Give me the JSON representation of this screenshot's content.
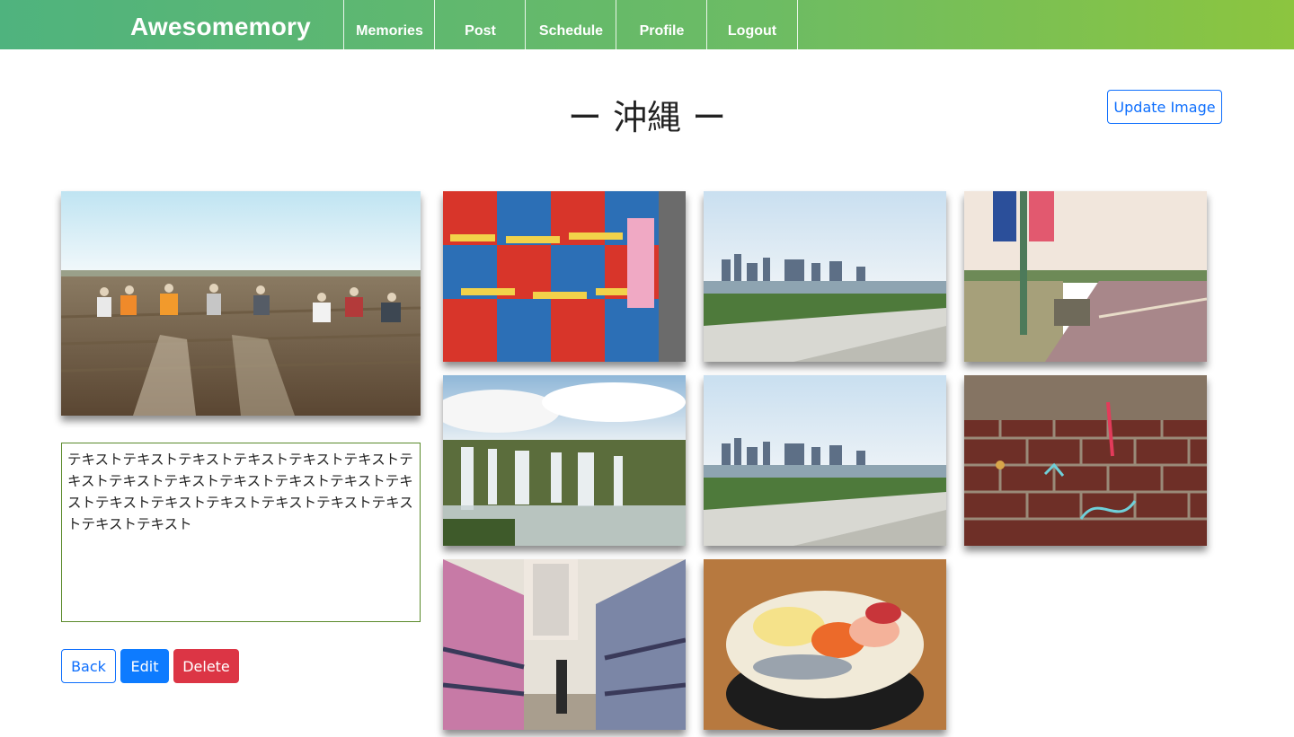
{
  "header": {
    "brand": "Awesomemory",
    "nav": [
      "Memories",
      "Post",
      "Schedule",
      "Profile",
      "Logout"
    ]
  },
  "page": {
    "title": "ー 沖縄 ー",
    "update_image_label": "Update Image"
  },
  "memo": {
    "text": "テキストテキストテキストテキストテキストテキストテキストテキストテキストテキストテキストテキストテキストテキストテキストテキストテキストテキストテキストテキストテキスト"
  },
  "actions": {
    "back": "Back",
    "edit": "Edit",
    "delete": "Delete"
  },
  "colors": {
    "header_start": "#4fb37e",
    "header_end": "#8cc53f",
    "primary": "#0d7bff",
    "danger": "#dc3545"
  },
  "photos": [
    "main-field-photo",
    "street-art-posters-photo",
    "city-river-photo",
    "road-sign-photo",
    "waterfall-photo",
    "city-river-photo-2",
    "brick-wall-gum-photo",
    "graffiti-alley-photo",
    "seafood-bowl-photo"
  ]
}
